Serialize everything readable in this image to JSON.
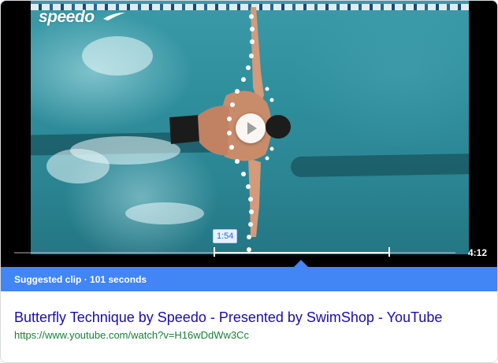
{
  "video": {
    "brand_logo_text": "speedo",
    "current_time_tooltip": "1:54",
    "duration": "4:12",
    "clip_start_fraction": 0.454,
    "clip_end_fraction": 0.85
  },
  "suggested_clip": {
    "label": "Suggested clip",
    "separator": " · ",
    "length": "101 seconds"
  },
  "result": {
    "title": "Butterfly Technique by Speedo - Presented by SwimShop - YouTube",
    "url": "https://www.youtube.com/watch?v=H16wDdWw3Cc"
  },
  "colors": {
    "accent_blue": "#4285f4",
    "link_title": "#1a0dab",
    "url_green": "#188038"
  },
  "icons": {
    "play": "play-icon",
    "logo_swoosh": "swoosh-icon"
  }
}
